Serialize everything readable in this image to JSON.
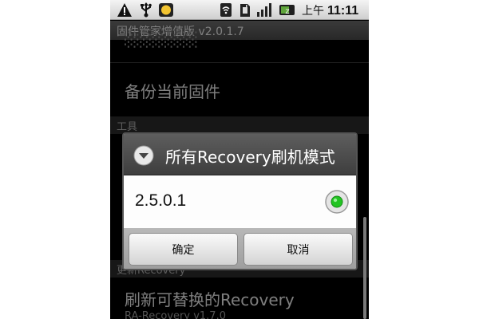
{
  "status_bar": {
    "ampm": "上午",
    "time": "11:11",
    "icons": [
      "warning-icon",
      "usb-icon",
      "notification-icon",
      "wifi-icon",
      "sd-card-icon",
      "signal-icon",
      "battery-icon"
    ]
  },
  "app": {
    "title": "固件管家增值版 v2.0.1.7"
  },
  "list": {
    "item_backup_title": "备份当前固件",
    "section_tools": "工具",
    "section_recovery": "更新Recovery",
    "item_flash_recovery_title": "刷新可替换的Recovery",
    "item_flash_recovery_sub": "RA-Recovery v1.7.0"
  },
  "dialog": {
    "title": "所有Recovery刷机模式",
    "options": [
      {
        "label": "2.5.0.1",
        "selected": true
      }
    ],
    "ok_label": "确定",
    "cancel_label": "取消"
  },
  "colors": {
    "radio_selected": "#22c422",
    "dialog_header": "#4a4a4a",
    "background": "#000000"
  }
}
